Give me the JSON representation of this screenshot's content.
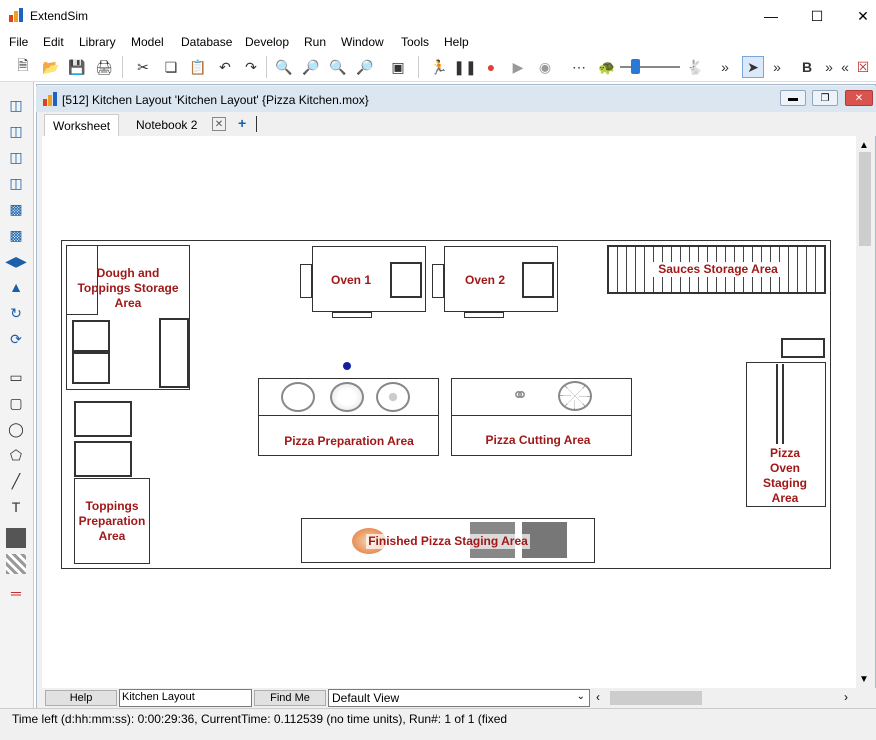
{
  "app": {
    "title": "ExtendSim"
  },
  "menubar": {
    "items": [
      "File",
      "Edit",
      "Library",
      "Model",
      "Database",
      "Develop",
      "Run",
      "Window",
      "Tools",
      "Help"
    ]
  },
  "document": {
    "title": "[512] Kitchen Layout 'Kitchen Layout'  {Pizza Kitchen.mox}",
    "tabs": [
      {
        "label": "Worksheet"
      },
      {
        "label": "Notebook 2"
      }
    ],
    "add_tab": "+"
  },
  "layout": {
    "areas": {
      "dough": "Dough and\nToppings Storage\nArea",
      "oven1": "Oven 1",
      "oven2": "Oven 2",
      "sauces": "Sauces Storage Area",
      "prep": "Pizza Preparation Area",
      "cutting": "Pizza Cutting Area",
      "oven_staging": "Pizza\nOven\nStaging\nArea",
      "toppings_prep": "Toppings\nPreparation\nArea",
      "finished": "Finished Pizza Staging Area"
    }
  },
  "bottombar": {
    "help_label": "Help",
    "layer_name": "Kitchen Layout",
    "findme_label": "Find Me",
    "view_select": "Default View"
  },
  "status": {
    "text": "Time left (d:hh:mm:ss): 0:00:29:36, CurrentTime: 0.112539 (no time units), Run#: 1 of 1 (fixed"
  },
  "colors": {
    "label_red": "#a01818",
    "accent_blue": "#1a5fa8"
  }
}
